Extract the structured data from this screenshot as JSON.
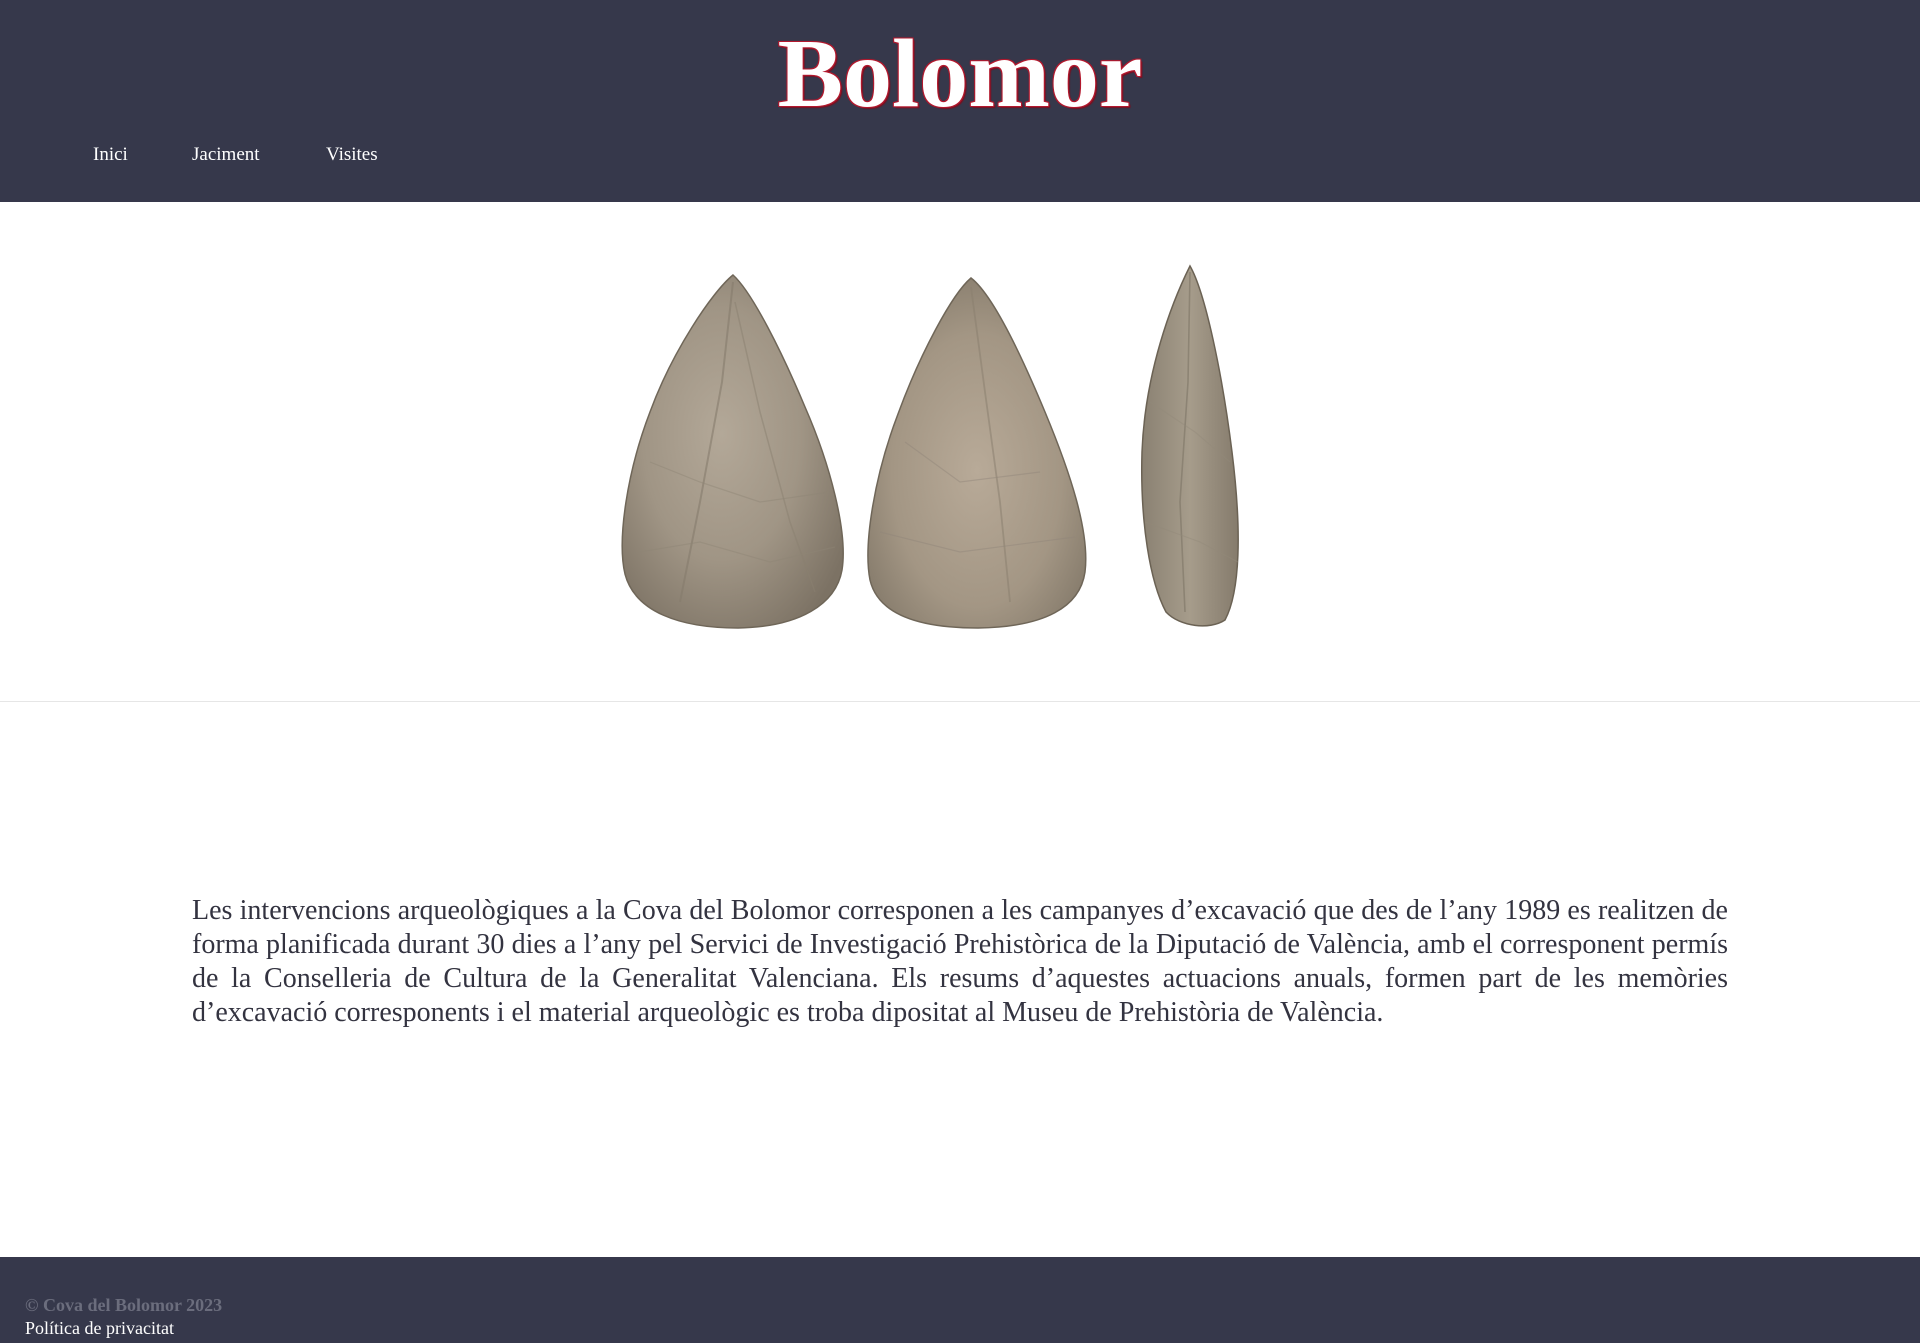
{
  "header": {
    "title": "Bolomor",
    "nav": [
      {
        "label": "Inici"
      },
      {
        "label": "Jaciment"
      },
      {
        "label": "Visites"
      }
    ]
  },
  "hero": {
    "image_icon": "handaxe-stone-tools-image"
  },
  "main": {
    "paragraph": "Les intervencions arqueològiques a la Cova del Bolomor corresponen a les campanyes d’excavació que des de l’any 1989 es realitzen de forma planificada durant 30 dies a l’any pel Servici de Investigació Prehistòrica de la Diputació de València, amb el corresponent permís de la Conselleria de Cultura de la Generalitat Valenciana. Els resums d’aquestes actuacions anuals, formen part de les memòries d’excavació corresponents i el material arqueològic es troba dipositat al Museu de Prehistòria de València."
  },
  "footer": {
    "copyright": "© Cova del Bolomor 2023",
    "privacy_link": "Política de privacitat"
  },
  "colors": {
    "header_bg": "#36384b",
    "title_outline": "#b3192e",
    "footer_bg": "#36384b",
    "stone": "#a39888"
  }
}
